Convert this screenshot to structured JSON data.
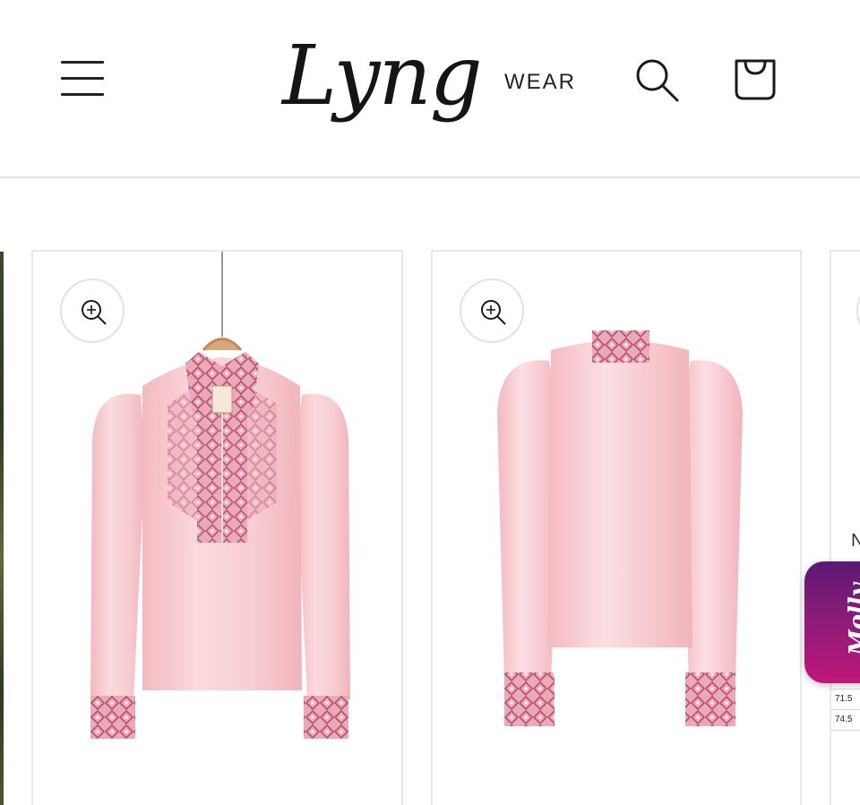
{
  "header": {
    "logo_main": "Lyng",
    "logo_sub": "WEAR",
    "menu_icon": "hamburger-menu-icon",
    "search_icon": "search-icon",
    "cart_icon": "shopping-bag-icon"
  },
  "gallery": {
    "slides": [
      {
        "zoom_icon": "zoom-in-icon",
        "image": "pink satin blouse with embroidered collar and cuffs, front view on hanger"
      },
      {
        "zoom_icon": "zoom-in-icon",
        "image": "pink satin blouse, back view"
      },
      {
        "zoom_icon": "zoom-in-icon",
        "partial_letter": "N",
        "size_rows": [
          "71.5",
          "74.5"
        ]
      }
    ]
  },
  "chat_widget": {
    "label": "Molly"
  },
  "colors": {
    "blouse_pink": "#f6c9cd",
    "embroidery": "#c96f86",
    "widget_purple": "#6a1b77",
    "widget_magenta": "#c0177b"
  }
}
